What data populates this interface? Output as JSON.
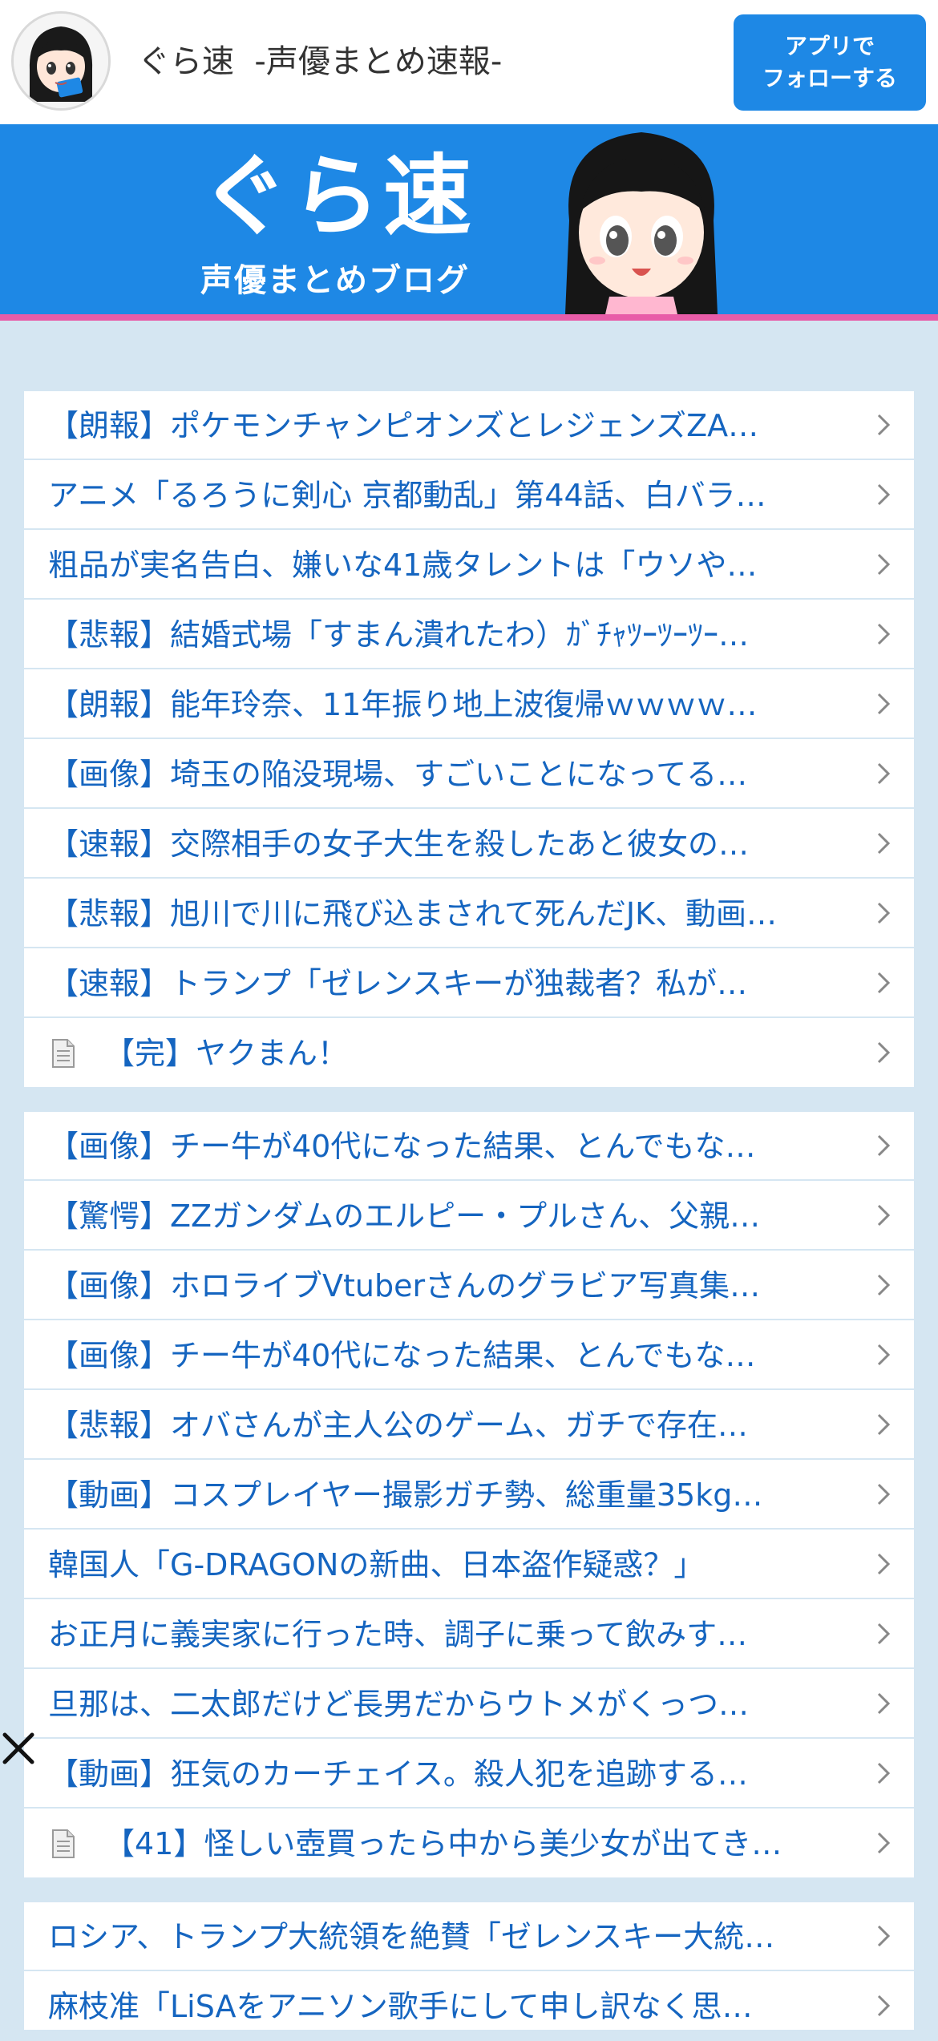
{
  "header": {
    "site_name": "ぐら速  -声優まとめ速報-",
    "follow_button": [
      "アプリで",
      "フォローする"
    ]
  },
  "banner": {
    "logo_text": "ぐら速",
    "subtitle": "声優まとめブログ",
    "colors": {
      "background": "#1e88e5",
      "stripe": "#e85ca8"
    }
  },
  "sections": [
    {
      "items": [
        {
          "text": "【朗報】ポケモンチャンピオンズとレジェンズZA…",
          "icon": null
        },
        {
          "text": "アニメ「るろうに剣心 京都動乱」第44話、白バラ…",
          "icon": null
        },
        {
          "text": "粗品が実名告白、嫌いな41歳タレントは「ウソや…",
          "icon": null
        },
        {
          "text": "【悲報】結婚式場「すまん潰れたわ）ｶﾞﾁｬﾂｰﾂｰﾂｰ…",
          "icon": null
        },
        {
          "text": "【朗報】能年玲奈、11年振り地上波復帰ｗｗｗｗ…",
          "icon": null
        },
        {
          "text": "【画像】埼玉の陥没現場、すごいことになってる…",
          "icon": null
        },
        {
          "text": "【速報】交際相手の女子大生を殺したあと彼女の…",
          "icon": null
        },
        {
          "text": "【悲報】旭川で川に飛び込まされて死んだJK、動画…",
          "icon": null
        },
        {
          "text": "【速報】トランプ「ゼレンスキーが独裁者？私が…",
          "icon": null
        },
        {
          "text": "【完】ヤクまん！",
          "icon": "document-icon"
        }
      ]
    },
    {
      "items": [
        {
          "text": "【画像】チー牛が40代になった結果、とんでもな…",
          "icon": null
        },
        {
          "text": "【驚愕】ZZガンダムのエルピー・プルさん、父親…",
          "icon": null
        },
        {
          "text": "【画像】ホロライブVtuberさんのグラビア写真集…",
          "icon": null
        },
        {
          "text": "【画像】チー牛が40代になった結果、とんでもな…",
          "icon": null
        },
        {
          "text": "【悲報】オバさんが主人公のゲーム、ガチで存在…",
          "icon": null
        },
        {
          "text": "【動画】コスプレイヤー撮影ガチ勢、総重量35kg…",
          "icon": null
        },
        {
          "text": "韓国人「G-DRAGONの新曲、日本盗作疑惑？」",
          "icon": null
        },
        {
          "text": "お正月に義実家に行った時、調子に乗って飲みす…",
          "icon": null
        },
        {
          "text": "旦那は、二太郎だけど長男だからウトメがくっつ…",
          "icon": null
        },
        {
          "text": "【動画】狂気のカーチェイス。殺人犯を追跡する…",
          "icon": null
        },
        {
          "text": "【41】怪しい壺買ったら中から美少女が出てき…",
          "icon": "document-icon"
        }
      ]
    },
    {
      "items": [
        {
          "text": "ロシア、トランプ大統領を絶賛「ゼレンスキー大統…",
          "icon": null
        },
        {
          "text": "麻枝准「LiSAをアニソン歌手にして申し訳なく思…",
          "icon": null
        }
      ]
    }
  ],
  "colors": {
    "page_bg": "#d5e6f2",
    "link": "#1565c0",
    "follow_button": "#1e88e5"
  }
}
